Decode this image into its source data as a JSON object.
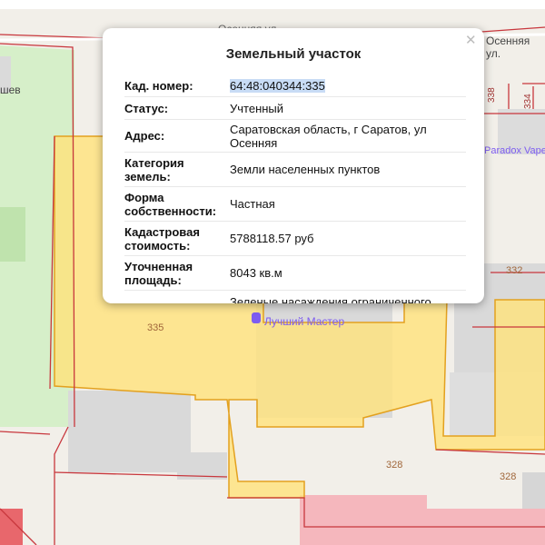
{
  "map": {
    "street_top": "Осенняя ул.",
    "street_top_right": "Осенняя ул.",
    "street_left": "шев",
    "parcel_labels": [
      "335",
      "332",
      "328",
      "328",
      "338",
      "334"
    ],
    "poi": [
      "Paradox Vape",
      "Лучший Мастер"
    ],
    "colors": {
      "parcel_fill": "#ffe27a",
      "parcel_border": "#e3a11f",
      "boundary": "#c8373d",
      "park": "#d6efc9",
      "building": "#d9d9d9",
      "pink_area": "#f5b7bd"
    }
  },
  "popup": {
    "title": "Земельный участок",
    "close_icon": "close-icon",
    "rows": [
      {
        "key": "Кад. номер:",
        "value": "64:48:040344:335"
      },
      {
        "key": "Статус:",
        "value": "Учтенный"
      },
      {
        "key": "Адрес:",
        "value": "Саратовская область, г Саратов, ул Осенняя"
      },
      {
        "key": "Категория земель:",
        "value": "Земли населенных пунктов"
      },
      {
        "key": "Форма собственности:",
        "value": "Частная"
      },
      {
        "key": "Кадастровая стоимость:",
        "value": "5788118.57 руб"
      },
      {
        "key": "Уточненная площадь:",
        "value": "8043 кв.м"
      },
      {
        "key": "",
        "value": "Зеленые насаждения ограниченного"
      }
    ]
  }
}
